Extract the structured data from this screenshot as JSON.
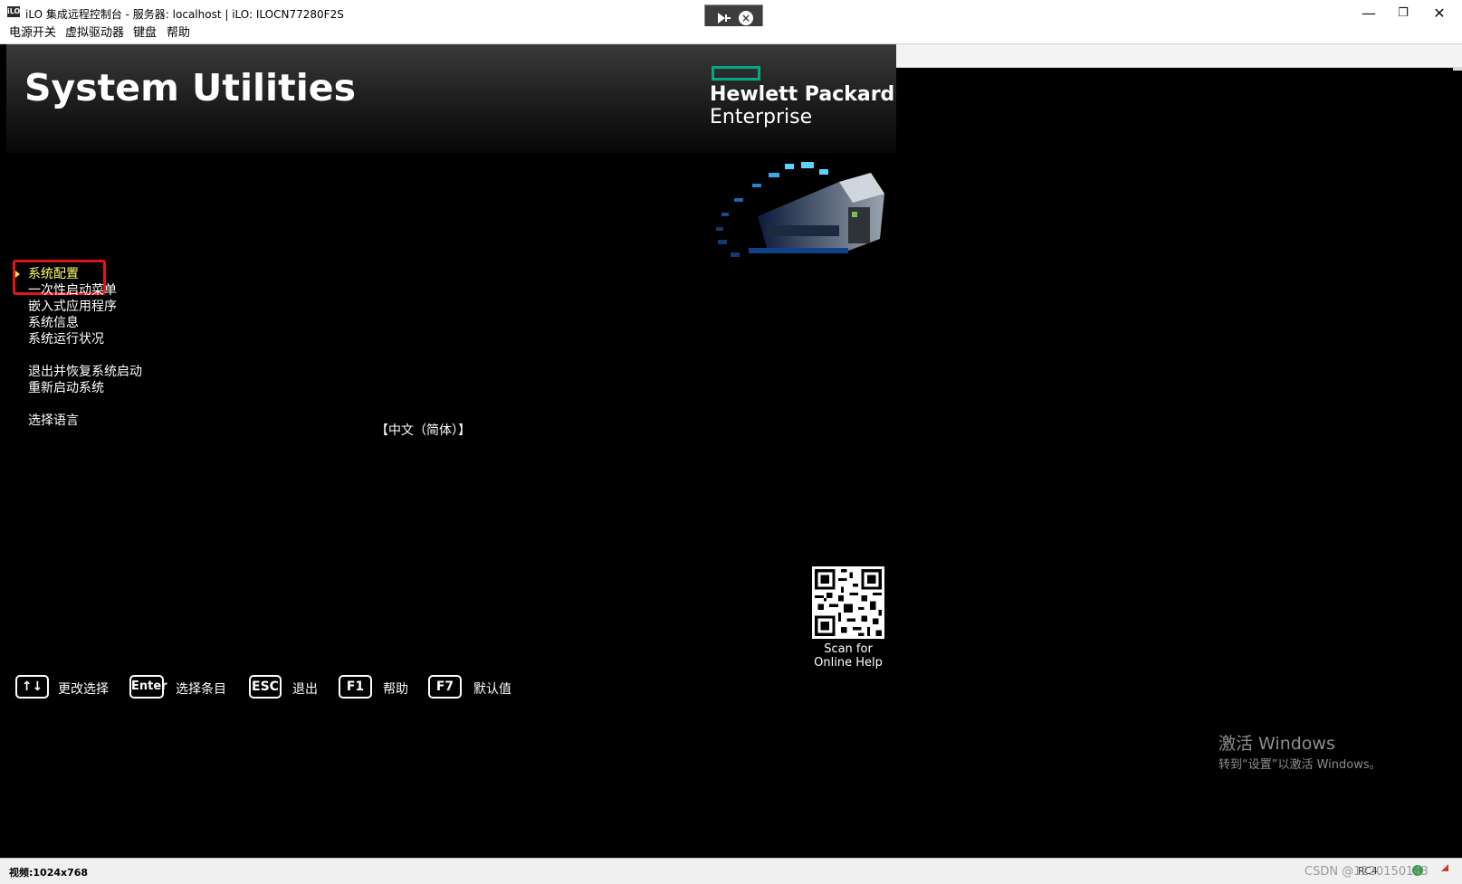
{
  "window": {
    "title": "iLO 集成远程控制台 - 服务器: localhost | iLO: ILOCN77280F2S",
    "app_icon_text": "iLO",
    "minimize_glyph": "—",
    "restore_glyph": "❐",
    "close_glyph": "✕"
  },
  "menubar": [
    "电源开关",
    "虚拟驱动器",
    "键盘",
    "帮助"
  ],
  "screen": {
    "title": "System Utilities",
    "logo": {
      "line1": "Hewlett Packard",
      "line2": "Enterprise",
      "bar_color": "#01a982"
    },
    "menu_items": [
      {
        "label": "系统配置",
        "selected": true
      },
      {
        "label": "一次性启动菜单",
        "selected": false
      },
      {
        "label": "嵌入式应用程序",
        "selected": false
      },
      {
        "label": "系统信息",
        "selected": false
      },
      {
        "label": "系统运行状况",
        "selected": false
      },
      {
        "label": "退出并恢复系统启动",
        "selected": false
      },
      {
        "label": "重新启动系统",
        "selected": false
      },
      {
        "label": "选择语言",
        "selected": false
      }
    ],
    "language_value": "【中文（简体）】",
    "qr_caption_line1": "Scan for",
    "qr_caption_line2": "Online Help",
    "keys": [
      {
        "key": "↑↓",
        "label": "更改选择"
      },
      {
        "key": "Enter",
        "label": "选择条目"
      },
      {
        "key": "ESC",
        "label": "退出"
      },
      {
        "key": "F1",
        "label": "帮助"
      },
      {
        "key": "F7",
        "label": "默认值"
      }
    ],
    "highlight_color": "#e01616",
    "selected_color": "#ffff66"
  },
  "watermark": {
    "title": "激活 Windows",
    "subtitle": "转到“设置”以激活 Windows。"
  },
  "statusbar": {
    "video": "视频:1024x768",
    "csdn": "CSDN @1220150143",
    "encryption": "RC4"
  }
}
